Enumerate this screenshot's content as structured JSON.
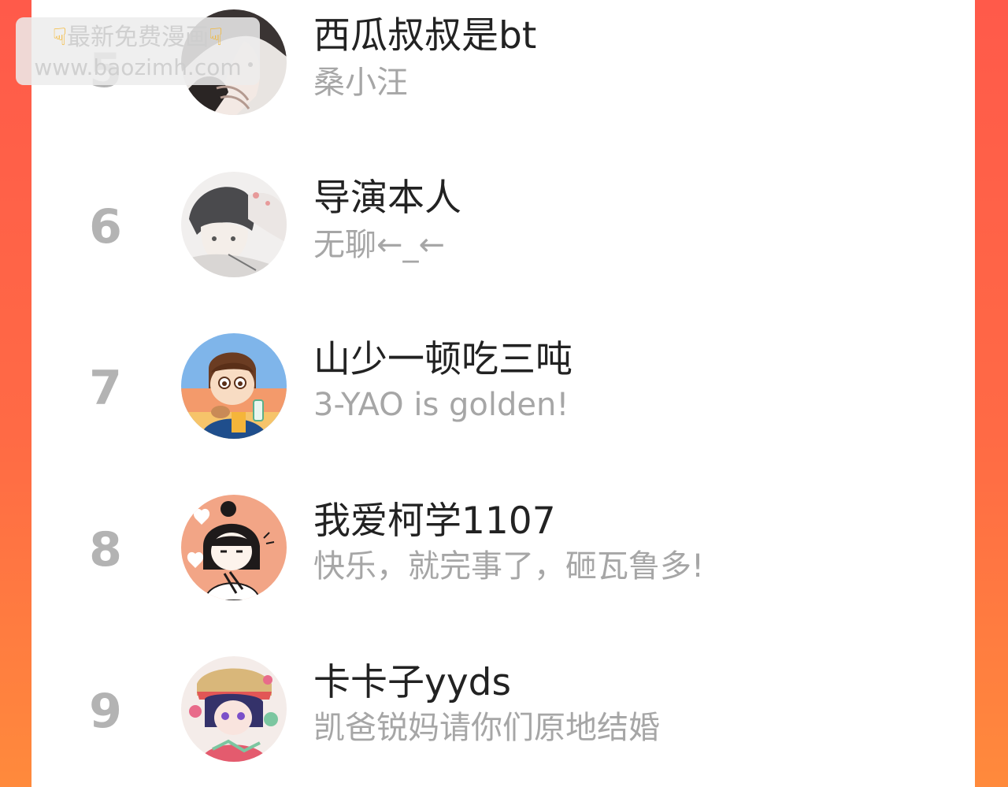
{
  "ranking": {
    "rows": [
      {
        "rank": "5",
        "name": "西瓜叔叔是bt",
        "signature": "桑小汪",
        "avatar_icon": "manga-girl-dark-hair-avatar-icon"
      },
      {
        "rank": "6",
        "name": "导演本人",
        "signature": "无聊←_←",
        "avatar_icon": "sketch-boy-avatar-icon"
      },
      {
        "rank": "7",
        "name": "山少一顿吃三吨",
        "signature": "3-YAO is golden!",
        "avatar_icon": "cartoon-boy-drink-avatar-icon"
      },
      {
        "rank": "8",
        "name": "我爱柯学1107",
        "signature": "快乐，就完事了，砸瓦鲁多!",
        "avatar_icon": "chibi-girl-hearts-avatar-icon"
      },
      {
        "rank": "9",
        "name": "卡卡子yyds",
        "signature": "凯爸锐妈请你们原地结婚",
        "avatar_icon": "colorful-anime-boy-avatar-icon"
      }
    ]
  },
  "watermark": {
    "line1": "最新免费漫画",
    "line2": "www.baozimh.com",
    "icon": "pointing-down-hand-icon"
  },
  "colors": {
    "background_top": "#ff5a4a",
    "background_bottom": "#ff8a3c",
    "panel": "#ffffff",
    "rank_number": "#b3b3b3",
    "name_text": "#222222",
    "signature_text": "#a6a6a6"
  }
}
